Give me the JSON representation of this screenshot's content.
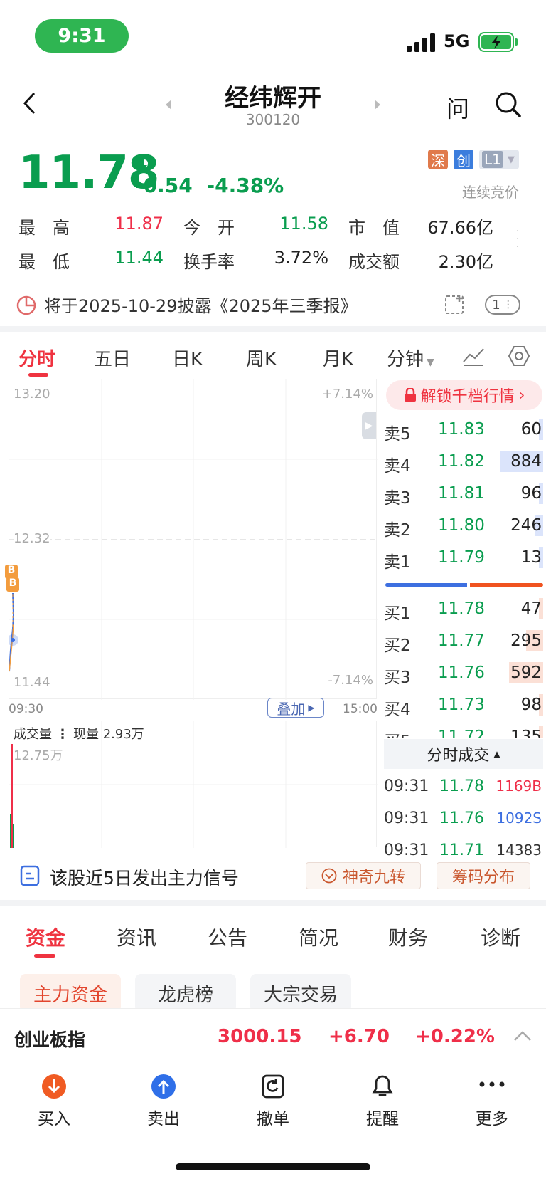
{
  "status": {
    "time": "9:31",
    "network": "5G"
  },
  "nav": {
    "title": "经纬辉开",
    "code": "300120",
    "ask": "问"
  },
  "quote": {
    "price": "11.78",
    "change": "-0.54",
    "change_pct": "-4.38%",
    "badges": [
      "深",
      "创",
      "L1"
    ],
    "mode": "连续竞价",
    "stats": [
      {
        "label": "最　高",
        "value": "11.87"
      },
      {
        "label": "今　开",
        "value": "11.58"
      },
      {
        "label": "市　值",
        "value": "67.66亿"
      },
      {
        "label": "最　低",
        "value": "11.44"
      },
      {
        "label": "换手率",
        "value": "3.72%"
      },
      {
        "label": "成交额",
        "value": "2.30亿"
      }
    ],
    "notice": "将于2025-10-29披露《2025年三季报》",
    "notice_count": "1"
  },
  "ktabs": [
    "分时",
    "五日",
    "日K",
    "周K",
    "月K",
    "分钟"
  ],
  "chart": {
    "y_top": "13.20",
    "y_mid": "12.32",
    "y_bot": "11.44",
    "pct_top": "+7.14%",
    "pct_bot": "-7.14%",
    "time_start": "09:30",
    "time_end": "15:00",
    "overlay_btn": "叠加",
    "markers": [
      "B",
      "B"
    ],
    "volume_title": "成交量",
    "volume_now": "现量 2.93万",
    "volume_max": "12.75万"
  },
  "orderbook": {
    "unlock": "解锁千档行情",
    "asks": [
      {
        "label": "卖5",
        "price": "11.83",
        "vol": "60",
        "bar": 0.02
      },
      {
        "label": "卖4",
        "price": "11.82",
        "vol": "884",
        "bar": 0.5
      },
      {
        "label": "卖3",
        "price": "11.81",
        "vol": "96",
        "bar": 0.03
      },
      {
        "label": "卖2",
        "price": "11.80",
        "vol": "246",
        "bar": 0.1
      },
      {
        "label": "卖1",
        "price": "11.79",
        "vol": "13",
        "bar": 0.01
      }
    ],
    "bids": [
      {
        "label": "买1",
        "price": "11.78",
        "vol": "47",
        "bar": 0.02
      },
      {
        "label": "买2",
        "price": "11.77",
        "vol": "295",
        "bar": 0.2
      },
      {
        "label": "买3",
        "price": "11.76",
        "vol": "592",
        "bar": 0.4
      },
      {
        "label": "买4",
        "price": "11.73",
        "vol": "98",
        "bar": 0.03
      },
      {
        "label": "买5",
        "price": "11.72",
        "vol": "135",
        "bar": 0.05
      }
    ],
    "ticks_title": "分时成交",
    "ticks": [
      {
        "time": "09:31",
        "price": "11.78",
        "vol": "1169B"
      },
      {
        "time": "09:31",
        "price": "11.76",
        "vol": "1092S"
      },
      {
        "time": "09:31",
        "price": "11.71",
        "vol": "14383"
      }
    ]
  },
  "signal": {
    "text": "该股近5日发出主力信号",
    "btn1": "神奇九转",
    "btn2": "筹码分布"
  },
  "btabs": [
    "资金",
    "资讯",
    "公告",
    "简况",
    "财务",
    "诊断"
  ],
  "chips": [
    "主力资金",
    "龙虎榜",
    "大宗交易"
  ],
  "index": {
    "name": "创业板指",
    "value": "3000.15",
    "change": "+6.70",
    "pct": "+0.22%"
  },
  "toolbar": [
    "买入",
    "卖出",
    "撤单",
    "提醒",
    "更多"
  ],
  "colors": {
    "up": "#ef2f49",
    "down": "#0a9d4f",
    "accent": "#ef3340"
  }
}
